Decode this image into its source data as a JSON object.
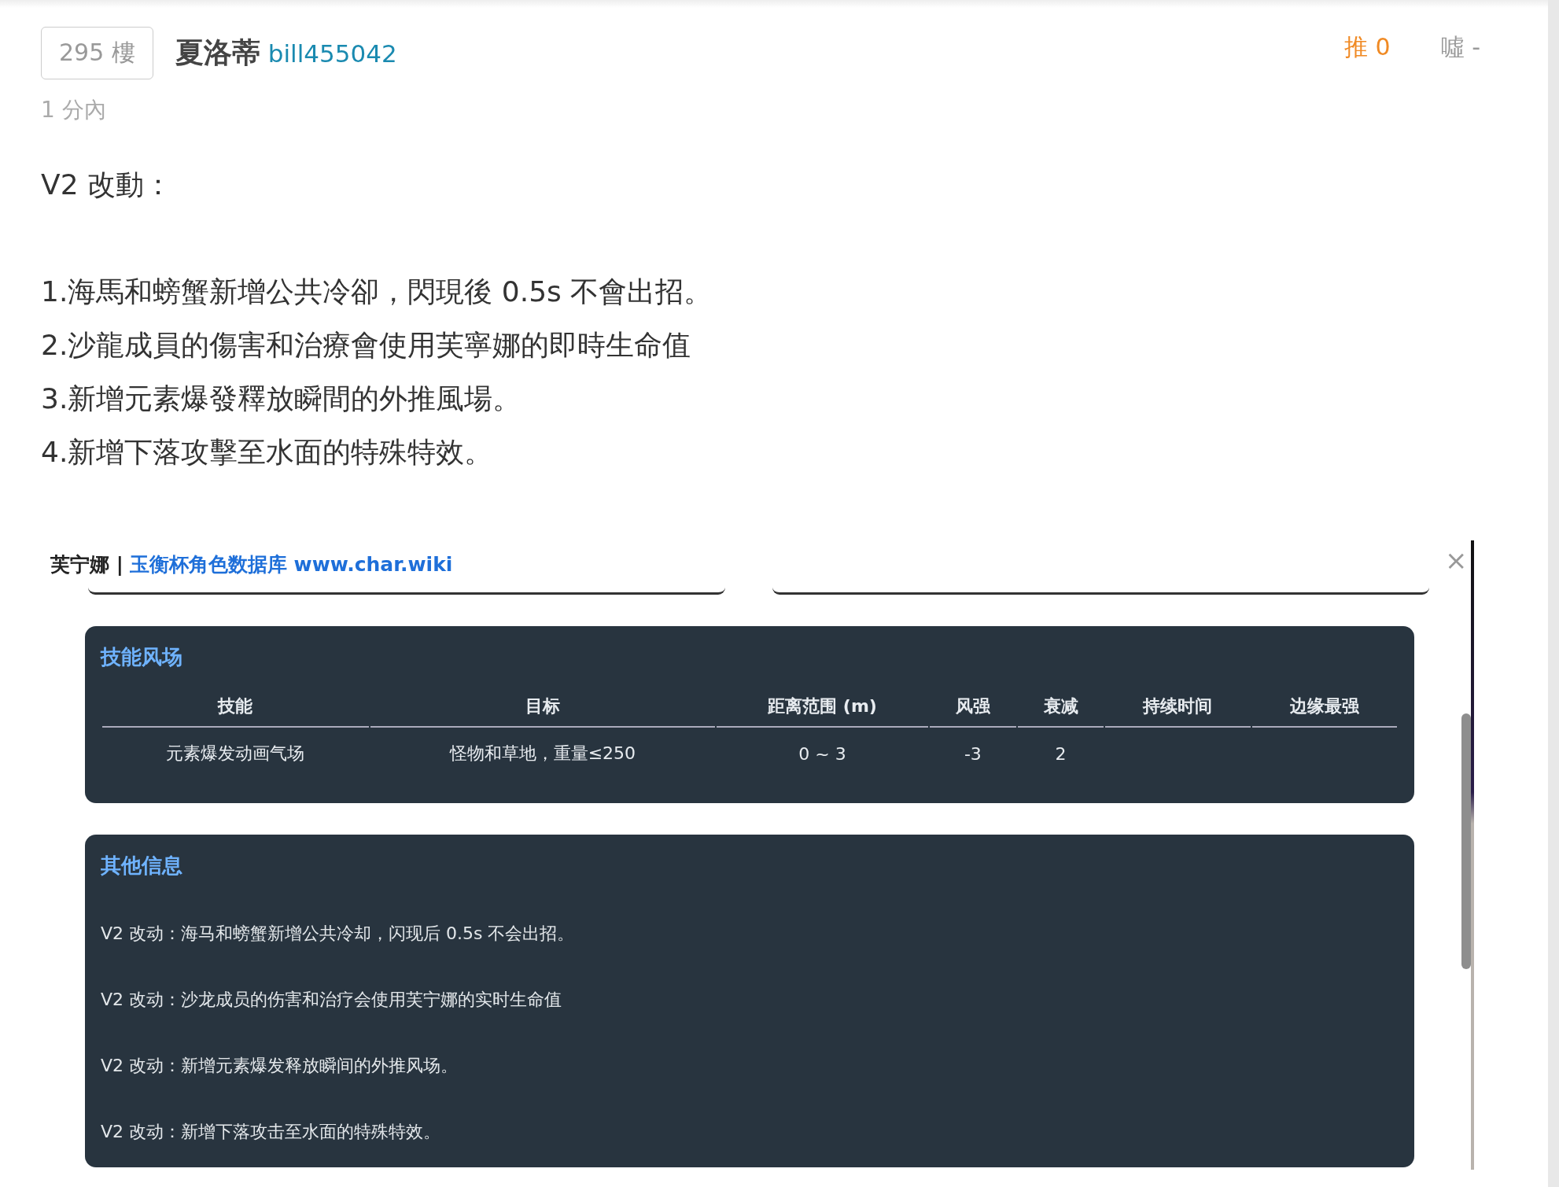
{
  "post": {
    "floor": "295 樓",
    "author_name": "夏洛蒂",
    "author_id": "bill455042",
    "time": "1 分內",
    "push_label": "推 0",
    "boo_label": "噓 -",
    "heading": "V2 改動：",
    "body": [
      "1.海馬和螃蟹新增公共冷卻，閃現後 0.5s 不會出招。",
      "2.沙龍成員的傷害和治療會使用芙寧娜的即時生命值",
      "3.新增元素爆發釋放瞬間的外推風場。",
      "4.新增下落攻擊至水面的特殊特效。"
    ]
  },
  "embedded_screenshot": {
    "title_prefix": "芙宁娜 |",
    "title_link": "玉衡杯角色数据库 www.char.wiki",
    "close": "×",
    "skill_card": {
      "title": "技能风场",
      "columns": [
        "技能",
        "目标",
        "距离范围 (m)",
        "风强",
        "衰减",
        "持续时间",
        "边缘最强"
      ],
      "rows": [
        [
          "元素爆发动画气场",
          "怪物和草地，重量≤250",
          "0 ~ 3",
          "-3",
          "2",
          "",
          ""
        ]
      ]
    },
    "info_card": {
      "title": "其他信息",
      "lines": [
        "V2 改动：海马和螃蟹新增公共冷却，闪现后 0.5s 不会出招。",
        "V2 改动：沙龙成员的伤害和治疗会使用芙宁娜的实时生命值",
        "V2 改动：新增元素爆发释放瞬间的外推风场。",
        "V2 改动：新增下落攻击至水面的特殊特效。"
      ]
    }
  }
}
